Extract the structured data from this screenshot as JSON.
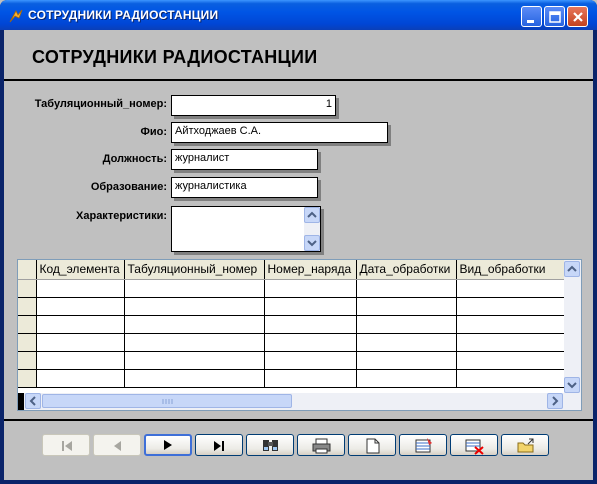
{
  "window": {
    "title": "СОТРУДНИКИ РАДИОСТАНЦИИ",
    "controls": [
      "minimize-icon",
      "maximize-icon",
      "close-icon"
    ]
  },
  "form": {
    "heading": "СОТРУДНИКИ РАДИОСТАНЦИИ",
    "fields": {
      "tab_number": {
        "label": "Табуляционный_номер:",
        "value": "1"
      },
      "fio": {
        "label": "Фио:",
        "value": "Айтходжаев С.А."
      },
      "position": {
        "label": "Должность:",
        "value": "журналист"
      },
      "education": {
        "label": "Образование:",
        "value": "журналистика"
      },
      "characteristics": {
        "label": "Характеристики:",
        "value": ""
      }
    }
  },
  "subform": {
    "columns": [
      "Код_элемента",
      "Табуляционный_номер",
      "Номер_наряда",
      "Дата_обработки",
      "Вид_обработки"
    ],
    "rows": [
      [
        "",
        "",
        "",
        "",
        ""
      ],
      [
        "",
        "",
        "",
        "",
        ""
      ],
      [
        "",
        "",
        "",
        "",
        ""
      ],
      [
        "",
        "",
        "",
        "",
        ""
      ],
      [
        "",
        "",
        "",
        "",
        ""
      ],
      [
        "",
        "",
        "",
        "",
        ""
      ]
    ]
  },
  "toolbar": {
    "buttons": [
      {
        "name": "first-record-button",
        "icon": "first-record-icon",
        "enabled": false
      },
      {
        "name": "previous-record-button",
        "icon": "previous-record-icon",
        "enabled": false
      },
      {
        "name": "next-record-button",
        "icon": "next-record-icon",
        "enabled": true
      },
      {
        "name": "last-record-button",
        "icon": "last-record-icon",
        "enabled": true
      },
      {
        "name": "find-record-button",
        "icon": "binoculars-icon",
        "enabled": true
      },
      {
        "name": "print-button",
        "icon": "printer-icon",
        "enabled": true
      },
      {
        "name": "new-record-button",
        "icon": "new-document-icon",
        "enabled": true
      },
      {
        "name": "save-record-button",
        "icon": "save-record-icon",
        "enabled": true
      },
      {
        "name": "delete-record-button",
        "icon": "delete-record-icon",
        "enabled": true
      },
      {
        "name": "close-form-button",
        "icon": "exit-folder-icon",
        "enabled": true
      }
    ]
  },
  "colors": {
    "titlebar": "#0055e5",
    "form_background": "#c0c0c0",
    "field_background": "#ffffff"
  }
}
